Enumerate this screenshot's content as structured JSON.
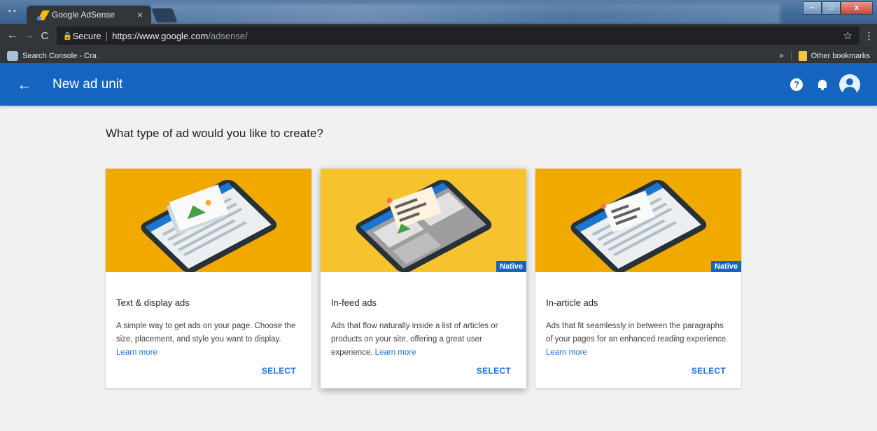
{
  "browser": {
    "tab_title": "Google AdSense",
    "tab_close": "×",
    "secure_label": "Secure",
    "url_host": "https://www.google.com",
    "url_path": "/adsense/",
    "bookmark_label": "Search Console - Cra",
    "bookmarks_overflow": "»",
    "other_bookmarks": "Other bookmarks",
    "window_controls": {
      "minimize": "–",
      "maximize": "□",
      "close": "x"
    }
  },
  "header": {
    "back_icon": "arrow-back-icon",
    "title": "New ad unit",
    "help": "?"
  },
  "main": {
    "question": "What type of ad would you like to create?",
    "cards": [
      {
        "title": "Text & display ads",
        "description": "A simple way to get ads on your page. Choose the size, placement, and style you want to display.",
        "learn_more": "Learn more",
        "select": "SELECT",
        "badge": "",
        "art_bg": "#f1a900"
      },
      {
        "title": "In-feed ads",
        "description": "Ads that flow naturally inside a list of articles or products on your site, offering a great user experience.",
        "learn_more": "Learn more",
        "select": "SELECT",
        "badge": "Native",
        "art_bg": "#f6c32e"
      },
      {
        "title": "In-article ads",
        "description": "Ads that fit seamlessly in between the paragraphs of your pages for an enhanced reading experience.",
        "learn_more": "Learn more",
        "select": "SELECT",
        "badge": "Native",
        "art_bg": "#f1a900"
      }
    ]
  },
  "colors": {
    "header_blue": "#1565c0",
    "link_blue": "#1a73e8",
    "page_bg": "#f1f1f1"
  }
}
